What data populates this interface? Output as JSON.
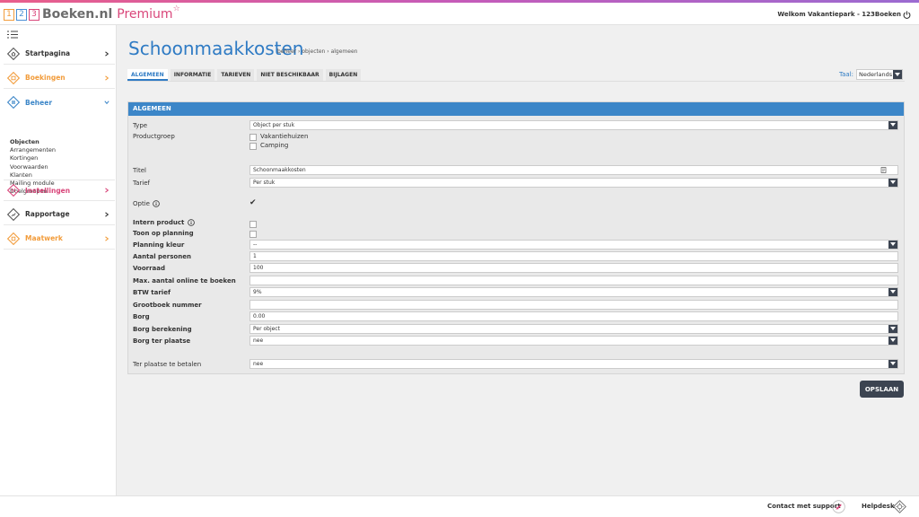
{
  "header": {
    "logo_digits": [
      "1",
      "2",
      "3"
    ],
    "logo_word": "Boeken.nl",
    "logo_premium": "Premium",
    "logo_star": "☆",
    "welcome": "Welkom Vakantiepark - 123Boeken"
  },
  "sidebar": {
    "items": [
      {
        "label": "Startpagina",
        "color": "#333333"
      },
      {
        "label": "Boekingen",
        "color": "#f29c3b"
      },
      {
        "label": "Beheer",
        "color": "#3c86c8"
      },
      {
        "label": "Instellingen",
        "color": "#d9467a"
      },
      {
        "label": "Rapportage",
        "color": "#333333"
      },
      {
        "label": "Maatwerk",
        "color": "#f29c3b"
      }
    ],
    "subitems": [
      "Objecten",
      "Arrangementen",
      "Kortingen",
      "Voorwaarden",
      "Klanten",
      "Mailing module",
      "Doelgroepen"
    ]
  },
  "page": {
    "title": "Schoonmaakkosten",
    "breadcrumb": "beheer › objecten › algemeen"
  },
  "tabs": [
    "ALGEMEEN",
    "INFORMATIE",
    "TARIEVEN",
    "NIET BESCHIKBAAR",
    "BIJLAGEN"
  ],
  "language": {
    "label": "Taal:",
    "value": "Nederlands"
  },
  "form": {
    "header": "ALGEMEEN",
    "type": {
      "label": "Type",
      "value": "Object per stuk"
    },
    "productgroep": {
      "label": "Productgroep",
      "options": [
        "Vakantiehuizen",
        "Camping"
      ]
    },
    "titel": {
      "label": "Titel",
      "value": "Schoonmaakkosten"
    },
    "tarief": {
      "label": "Tarief",
      "value": "Per stuk"
    },
    "optie": {
      "label": "Optie",
      "check": "✔"
    },
    "intern_product": {
      "label": "Intern product"
    },
    "toon_op_planning": {
      "label": "Toon op planning"
    },
    "planning_kleur": {
      "label": "Planning kleur",
      "value": "--"
    },
    "aantal_personen": {
      "label": "Aantal personen",
      "value": "1"
    },
    "voorraad": {
      "label": "Voorraad",
      "value": "100"
    },
    "max_online": {
      "label": "Max. aantal online te boeken",
      "value": ""
    },
    "btw_tarief": {
      "label": "BTW tarief",
      "value": "9%"
    },
    "grootboek": {
      "label": "Grootboek nummer",
      "value": ""
    },
    "borg": {
      "label": "Borg",
      "value": "0.00"
    },
    "borg_berekening": {
      "label": "Borg berekening",
      "value": "Per object"
    },
    "borg_ter_plaatse": {
      "label": "Borg ter plaatse",
      "value": "nee"
    },
    "ter_plaatse_betalen": {
      "label": "Ter plaatse te betalen",
      "value": "nee"
    }
  },
  "save_label": "OPSLAAN",
  "footer": {
    "support": "Contact met support",
    "helpdesk": "Helpdesk"
  }
}
